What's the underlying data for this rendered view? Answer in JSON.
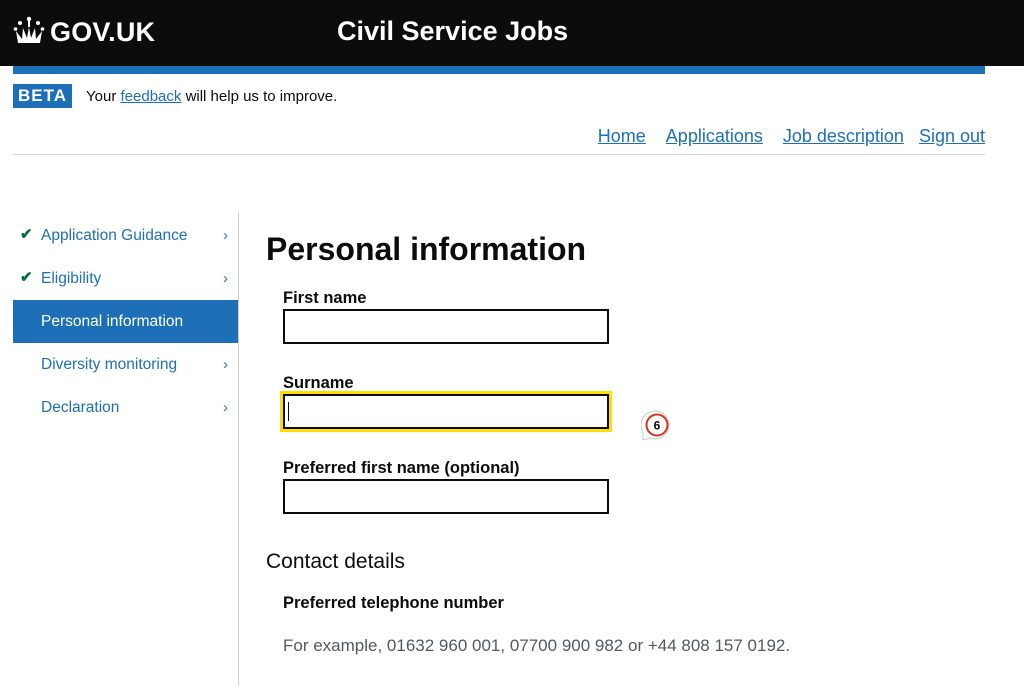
{
  "header": {
    "logo_text": "GOV.UK",
    "service_name": "Civil Service Jobs"
  },
  "phase_banner": {
    "tag": "BETA",
    "text_before": "Your",
    "link": "feedback",
    "text_after": "will help us to improve."
  },
  "nav": {
    "items": [
      "Home",
      "Applications",
      "Job description",
      "Sign out"
    ]
  },
  "sidebar": {
    "items": [
      {
        "label": "Application Guidance",
        "completed": true,
        "active": false
      },
      {
        "label": "Eligibility",
        "completed": true,
        "active": false
      },
      {
        "label": "Personal information",
        "completed": false,
        "active": true
      },
      {
        "label": "Diversity monitoring",
        "completed": false,
        "active": false
      },
      {
        "label": "Declaration",
        "completed": false,
        "active": false
      }
    ],
    "chevron": "›",
    "check": "✔"
  },
  "main": {
    "title": "Personal information",
    "fields": [
      {
        "label": "First name",
        "value": ""
      },
      {
        "label": "Surname",
        "value": ""
      },
      {
        "label": "Preferred first name (optional)",
        "value": ""
      }
    ],
    "contact_heading": "Contact details",
    "phone_label": "Preferred telephone number",
    "phone_hint": "For example, 01632 960 001, 07700 900 982 or +44 808 157 0192."
  },
  "marker": {
    "number": "6"
  },
  "colors": {
    "brand_blue": "#1d70b8",
    "header_black": "#0b0c0c",
    "focus_yellow": "#ffdd00",
    "check_green": "#00703c"
  }
}
